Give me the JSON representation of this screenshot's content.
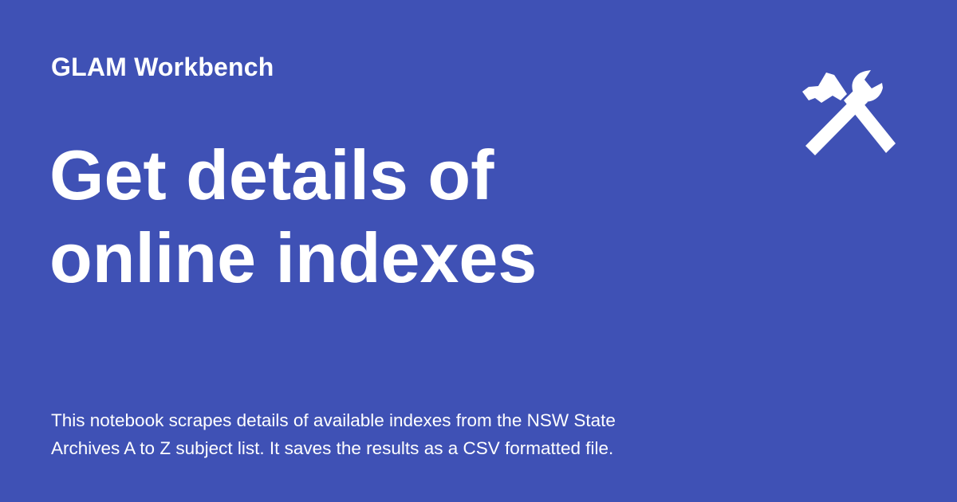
{
  "brand": {
    "site_name": "GLAM Workbench",
    "background_color": "#3F51B5",
    "text_color": "#FFFFFF"
  },
  "page": {
    "title_lines": [
      "Get details of",
      "online indexes"
    ],
    "description_lines": [
      "This notebook scrapes details of available indexes from the NSW State",
      "Archives A to Z subject list. It saves the results as a CSV formatted file."
    ]
  },
  "icons": {
    "decoration": "hammer-and-wrench-icon"
  }
}
